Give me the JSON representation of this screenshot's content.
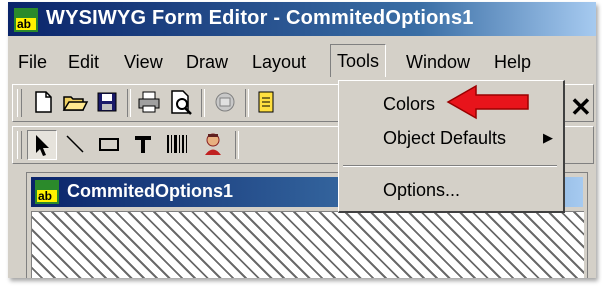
{
  "window": {
    "title": "WYSIWYG Form Editor - CommitedOptions1"
  },
  "menubar": {
    "items": [
      {
        "label": "File"
      },
      {
        "label": "Edit"
      },
      {
        "label": "View"
      },
      {
        "label": "Draw"
      },
      {
        "label": "Layout"
      },
      {
        "label": "Tools"
      },
      {
        "label": "Window"
      },
      {
        "label": "Help"
      }
    ]
  },
  "tools_menu": {
    "items": [
      {
        "label": "Colors",
        "highlighted_callout": true
      },
      {
        "label": "Object Defaults",
        "has_submenu": true
      },
      {
        "label": "Options..."
      }
    ]
  },
  "toolbar1": {
    "icons": [
      "new-document-icon",
      "open-folder-icon",
      "save-icon",
      "print-icon",
      "print-preview-icon",
      "spell-check-icon",
      "note-icon"
    ]
  },
  "toolbar2": {
    "icons": [
      "pointer-tool-icon",
      "line-tool-icon",
      "rectangle-tool-icon",
      "text-tool-icon",
      "barcode-tool-icon",
      "image-tool-icon"
    ]
  },
  "child_window": {
    "title": "CommitedOptions1"
  },
  "colors": {
    "annotation_arrow": "#e8141b",
    "title_gradient_start": "#0a246a"
  }
}
